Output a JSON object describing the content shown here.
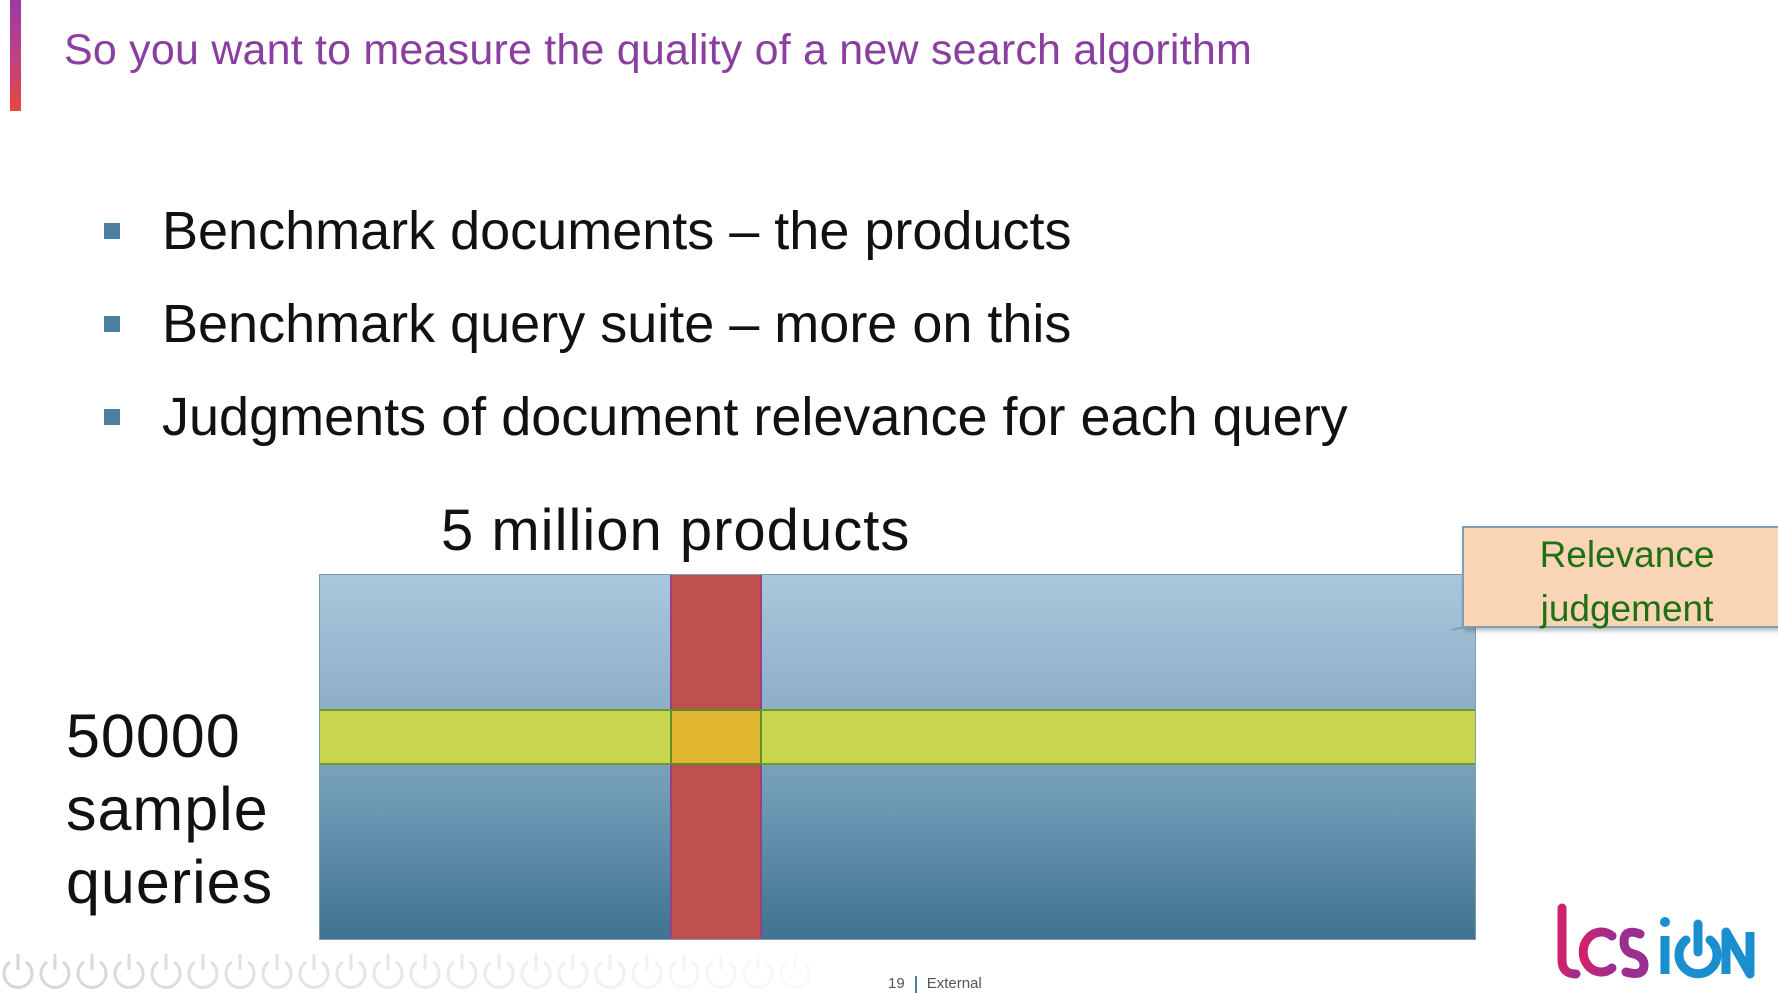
{
  "slide": {
    "title": "So you want to measure the quality of a new search algorithm",
    "bullets": [
      {
        "text": "Benchmark documents – the products"
      },
      {
        "text": "Benchmark query suite – more on this"
      },
      {
        "text": "Judgments of document relevance for each query"
      }
    ]
  },
  "diagram": {
    "x_label": "5 million products",
    "y_label_lines": [
      "50000",
      "sample",
      "queries"
    ],
    "callout_lines": [
      "Relevance",
      "judgement"
    ]
  },
  "footer": {
    "page_number": "19",
    "classification": "External",
    "logo_icon": "tcs-ion-logo-icon"
  },
  "colors": {
    "title": "#8a3fa0",
    "bullet": "#4a7fa0",
    "matrix_top": "#a9c7dc",
    "matrix_bottom": "#3f7391",
    "query_row": "#c8d64f",
    "product_column": "#c0504d",
    "intersection": "#e0b52f",
    "callout_fill": "#fad5b5",
    "callout_text": "#1f6f14"
  }
}
